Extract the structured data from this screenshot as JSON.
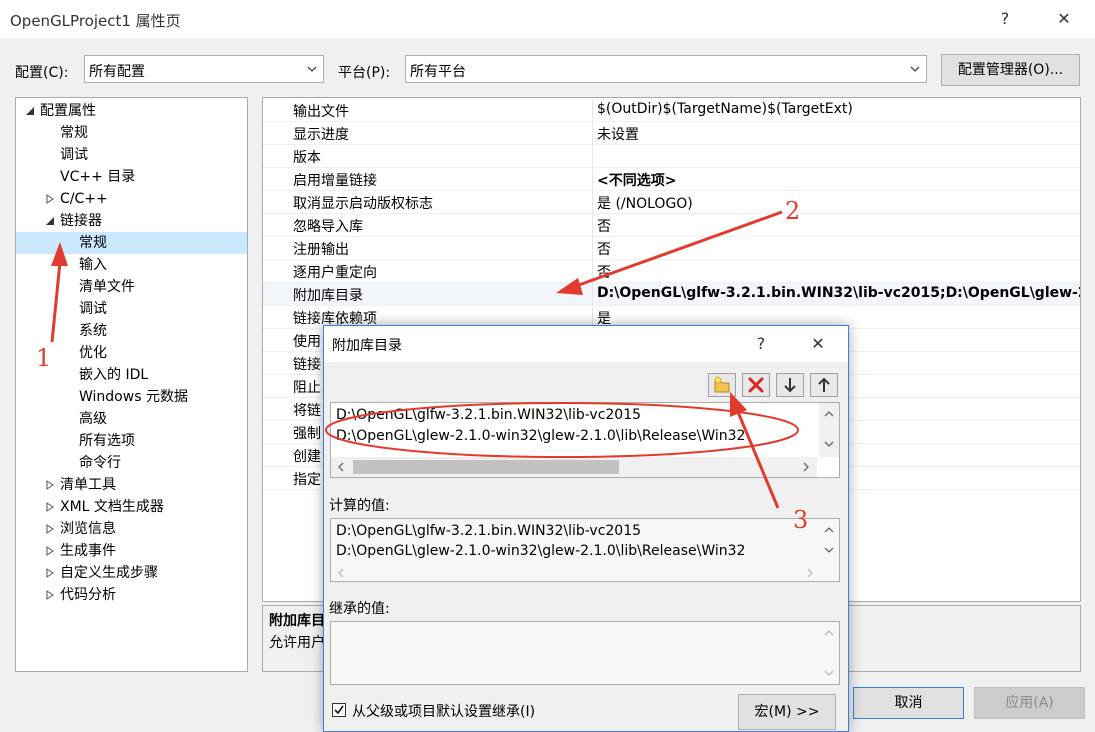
{
  "window": {
    "title": "OpenGLProject1 属性页",
    "help_label": "?",
    "close_label": "✕"
  },
  "config": {
    "config_label": "配置(C):",
    "config_value": "所有配置",
    "platform_label": "平台(P):",
    "platform_value": "所有平台",
    "manager_button": "配置管理器(O)..."
  },
  "tree": {
    "items": [
      {
        "label": "配置属性",
        "expander": "expanded"
      },
      {
        "label": "常规",
        "expander": "none"
      },
      {
        "label": "调试",
        "expander": "none"
      },
      {
        "label": "VC++ 目录",
        "expander": "none"
      },
      {
        "label": "C/C++",
        "expander": "collapsed"
      },
      {
        "label": "链接器",
        "expander": "expanded"
      },
      {
        "label": "常规",
        "expander": "none",
        "selected": true
      },
      {
        "label": "输入",
        "expander": "none"
      },
      {
        "label": "清单文件",
        "expander": "none"
      },
      {
        "label": "调试",
        "expander": "none"
      },
      {
        "label": "系统",
        "expander": "none"
      },
      {
        "label": "优化",
        "expander": "none"
      },
      {
        "label": "嵌入的 IDL",
        "expander": "none"
      },
      {
        "label": "Windows 元数据",
        "expander": "none"
      },
      {
        "label": "高级",
        "expander": "none"
      },
      {
        "label": "所有选项",
        "expander": "none"
      },
      {
        "label": "命令行",
        "expander": "none"
      },
      {
        "label": "清单工具",
        "expander": "collapsed"
      },
      {
        "label": "XML 文档生成器",
        "expander": "collapsed"
      },
      {
        "label": "浏览信息",
        "expander": "collapsed"
      },
      {
        "label": "生成事件",
        "expander": "collapsed"
      },
      {
        "label": "自定义生成步骤",
        "expander": "collapsed"
      },
      {
        "label": "代码分析",
        "expander": "collapsed"
      }
    ]
  },
  "grid": {
    "rows": [
      {
        "name": "输出文件",
        "value": "$(OutDir)$(TargetName)$(TargetExt)"
      },
      {
        "name": "显示进度",
        "value": "未设置"
      },
      {
        "name": "版本",
        "value": ""
      },
      {
        "name": "启用增量链接",
        "value": "<不同选项>",
        "bold": true
      },
      {
        "name": "取消显示启动版权标志",
        "value": "是 (/NOLOGO)"
      },
      {
        "name": "忽略导入库",
        "value": "否"
      },
      {
        "name": "注册输出",
        "value": "否"
      },
      {
        "name": "逐用户重定向",
        "value": "否"
      },
      {
        "name": "附加库目录",
        "value": "D:\\OpenGL\\glfw-3.2.1.bin.WIN32\\lib-vc2015;D:\\OpenGL\\glew-2.",
        "bold": true,
        "highlight": true
      },
      {
        "name": "链接库依赖项",
        "value": "是"
      },
      {
        "name": "使用",
        "value": ""
      },
      {
        "name": "链接",
        "value": ""
      },
      {
        "name": "阻止",
        "value": ""
      },
      {
        "name": "将链",
        "value": ""
      },
      {
        "name": "强制",
        "value": ""
      },
      {
        "name": "创建",
        "value": ""
      },
      {
        "name": "指定",
        "value": ""
      }
    ]
  },
  "desc": {
    "title": "附加库目",
    "text": "允许用户"
  },
  "footer": {
    "cancel_button": "取消",
    "apply_button": "应用(A)"
  },
  "dialog": {
    "title": "附加库目录",
    "help_label": "?",
    "close_label": "✕",
    "entries": [
      "D:\\OpenGL\\glfw-3.2.1.bin.WIN32\\lib-vc2015",
      "D:\\OpenGL\\glew-2.1.0-win32\\glew-2.1.0\\lib\\Release\\Win32"
    ],
    "computed_label": "计算的值:",
    "computed": [
      "D:\\OpenGL\\glfw-3.2.1.bin.WIN32\\lib-vc2015",
      "D:\\OpenGL\\glew-2.1.0-win32\\glew-2.1.0\\lib\\Release\\Win32"
    ],
    "inherited_label": "继承的值:",
    "inherit_checkbox_label": "从父级或项目默认设置继承(I)",
    "inherit_checked": true,
    "macro_button": "宏(M) >>"
  },
  "annotations": {
    "n1": "1",
    "n2": "2",
    "n3": "3",
    "color": "#e23a2c"
  }
}
